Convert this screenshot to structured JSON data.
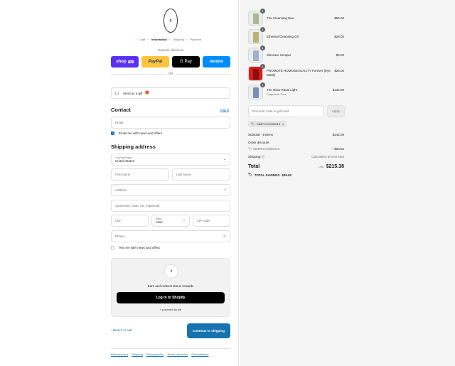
{
  "brand": {
    "logo_glyph": "⚱"
  },
  "breadcrumbs": [
    "Cart",
    "Information",
    "Shipping",
    "Payment"
  ],
  "express": {
    "title": "Express checkout",
    "shop_label": "shop",
    "shop_tag": "Pay",
    "paypal_label": "PayPal",
    "gpay_label": "G Pay",
    "venmo_label": "venmo",
    "or_label": "OR"
  },
  "gift": {
    "label": "Send as a gift"
  },
  "contact": {
    "heading": "Contact",
    "login_label": "Log in",
    "email_placeholder": "Email",
    "news_label": "Email me with news and offers"
  },
  "shipping": {
    "heading": "Shipping address",
    "country_label": "Country/Region",
    "country_value": "United States",
    "first_name": "First name",
    "last_name": "Last name",
    "address": "Address",
    "apartment": "Apartment, suite, etc. (optional)",
    "city": "City",
    "state_label": "State",
    "state_value": "Iowa",
    "zip": "ZIP code",
    "phone": "Phone",
    "sms_label": "Text me with news and offers"
  },
  "rewards": {
    "text": "Earn and redeem Dieux rewards",
    "button": "Log in to Shopify",
    "powered": "+ powered by tyb"
  },
  "nav": {
    "return": "Return to cart",
    "continue": "Continue to shipping"
  },
  "policies": [
    "Refund policy",
    "Shipping",
    "Privacy policy",
    "Terms of service",
    "Cancellations"
  ],
  "cart": {
    "items": [
      {
        "name": "The Cleansing Duo",
        "sub": "",
        "price": "$55.00",
        "qty": "1",
        "color": "#a9b98f"
      },
      {
        "name": "Ethereal Cleansing Oil",
        "sub": "",
        "price": "$28.00",
        "qty": "1",
        "color": "#b9b27a"
      },
      {
        "name": "Skincare Scraper",
        "sub": "",
        "price": "$2.00",
        "qty": "1",
        "color": "#9fb2c6"
      },
      {
        "name": "PROMOTE HOMOSEXUALITY Forever (Eye Mask)",
        "sub": "",
        "price": "$25.00",
        "qty": "1",
        "color": "#d41f1f"
      },
      {
        "name": "The Glow Ritual Light",
        "sub": "Fragrance-Free",
        "price": "$132.00",
        "qty": "1",
        "color": "#7a8db3"
      }
    ]
  },
  "discount": {
    "placeholder": "Discount code or gift card",
    "apply": "Apply",
    "chip": "SIMPLYCODES10",
    "chip_close": "×"
  },
  "summary": {
    "subtotal_label": "Subtotal · 5 items",
    "subtotal": "$242.00",
    "order_discount_label": "Order discount",
    "code_label": "SIMPLYCODES10",
    "code_amount": "– $26.62",
    "shipping_label": "Shipping",
    "shipping_value": "Calculated at next step",
    "total_label": "Total",
    "currency": "USD",
    "total": "$215.38",
    "savings_label": "TOTAL SAVINGS",
    "savings": "$26.62"
  }
}
